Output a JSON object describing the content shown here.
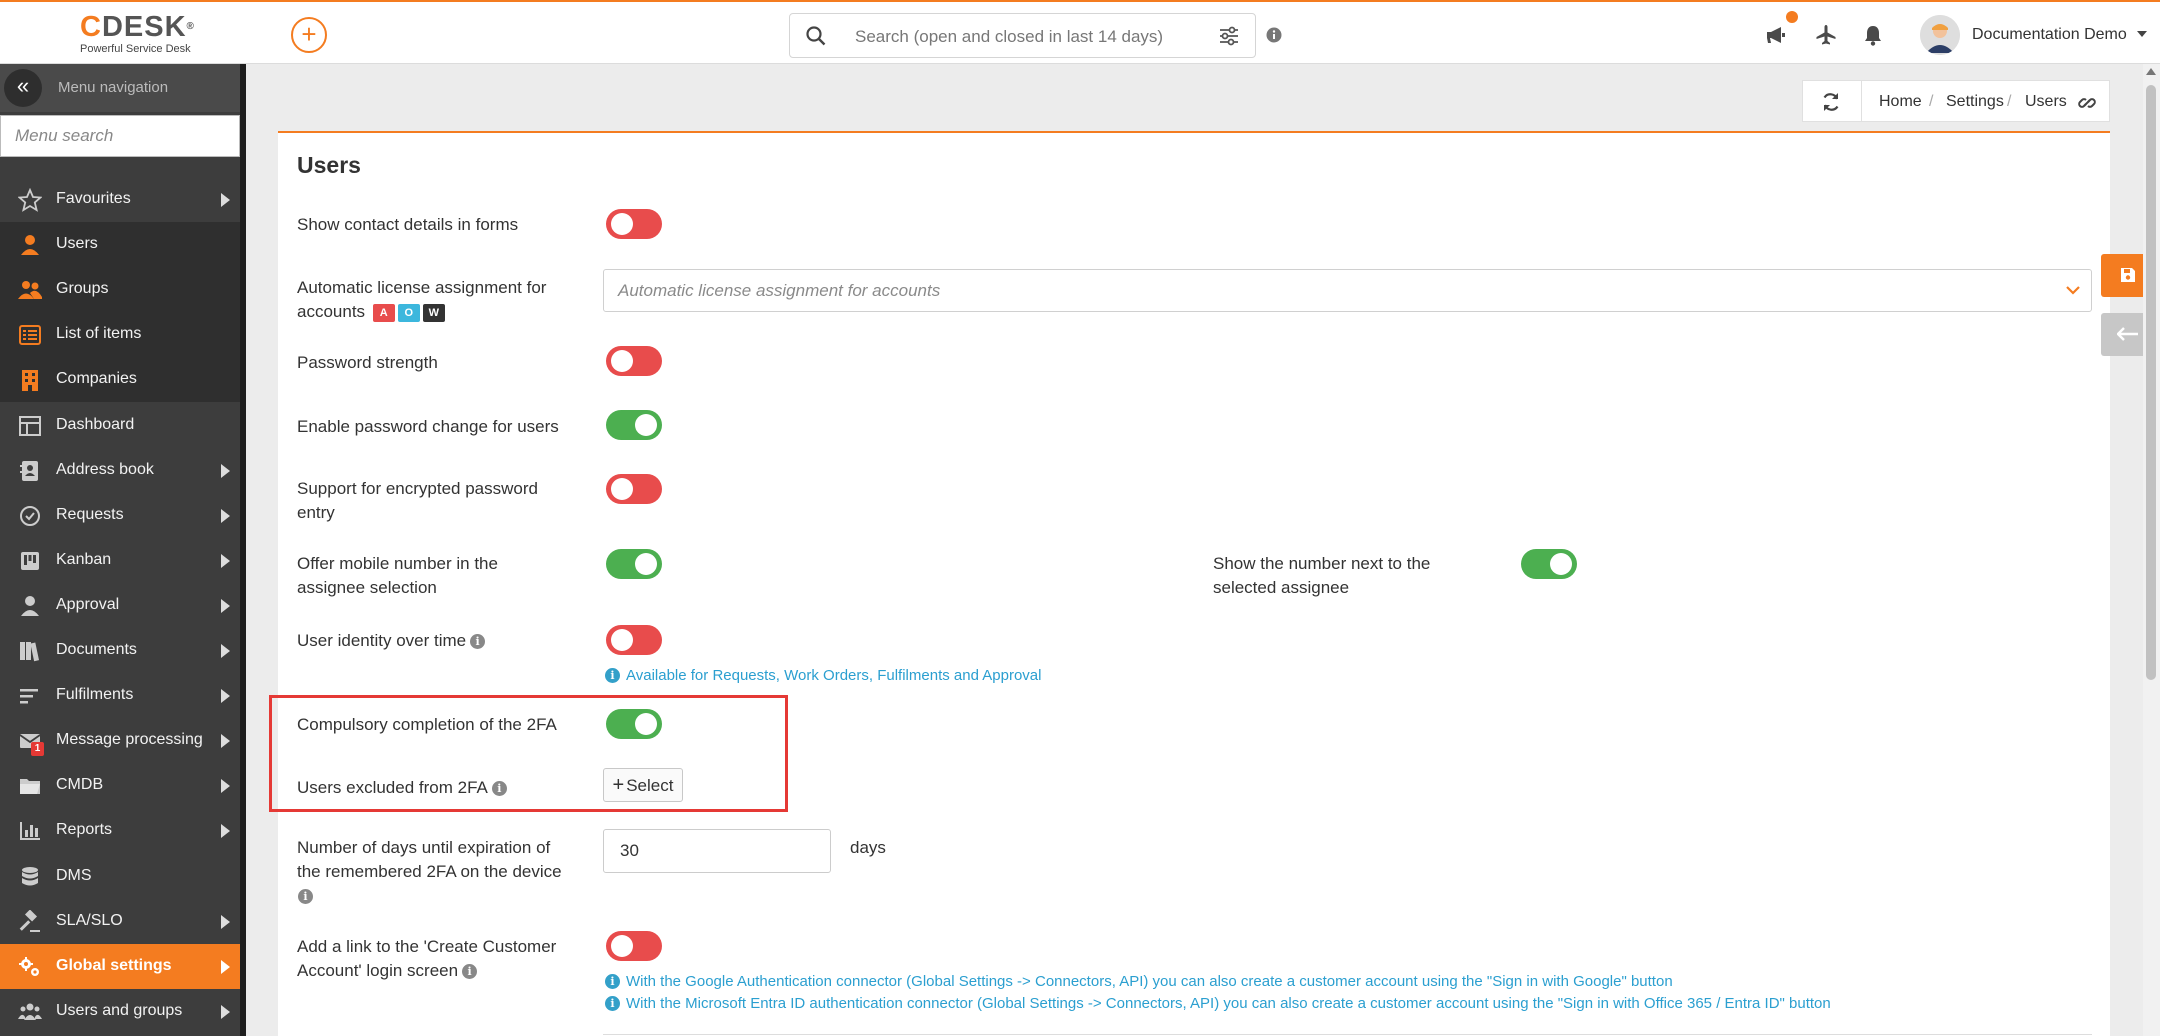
{
  "header": {
    "logo_text": "CDESK",
    "logo_sup": "®",
    "logo_subtitle": "Powerful Service Desk",
    "search_placeholder": "Search (open and closed in last 14 days)",
    "user_name": "Documentation Demo",
    "accent_color": "#f47c20"
  },
  "sidebar": {
    "nav_label": "Menu navigation",
    "search_placeholder": "Menu search",
    "items": [
      {
        "label": "Favourites",
        "icon": "star-icon",
        "submenu": true
      },
      {
        "label": "Users",
        "icon": "user-icon",
        "submenu": false
      },
      {
        "label": "Groups",
        "icon": "group-icon",
        "submenu": false
      },
      {
        "label": "List of items",
        "icon": "list-icon",
        "submenu": false
      },
      {
        "label": "Companies",
        "icon": "building-icon",
        "submenu": false
      },
      {
        "label": "Dashboard",
        "icon": "dashboard-icon",
        "submenu": false
      },
      {
        "label": "Address book",
        "icon": "address-book-icon",
        "submenu": true
      },
      {
        "label": "Requests",
        "icon": "requests-icon",
        "submenu": true
      },
      {
        "label": "Kanban",
        "icon": "kanban-icon",
        "submenu": true
      },
      {
        "label": "Approval",
        "icon": "approval-icon",
        "submenu": true
      },
      {
        "label": "Documents",
        "icon": "documents-icon",
        "submenu": true
      },
      {
        "label": "Fulfilments",
        "icon": "fulfilments-icon",
        "submenu": true
      },
      {
        "label": "Message processing",
        "icon": "envelope-icon",
        "submenu": true,
        "badge": "1"
      },
      {
        "label": "CMDB",
        "icon": "folder-icon",
        "submenu": true
      },
      {
        "label": "Reports",
        "icon": "chart-icon",
        "submenu": true
      },
      {
        "label": "DMS",
        "icon": "database-icon",
        "submenu": false
      },
      {
        "label": "SLA/SLO",
        "icon": "gavel-icon",
        "submenu": true
      },
      {
        "label": "Global settings",
        "icon": "cogs-icon",
        "submenu": true,
        "active": true
      },
      {
        "label": "Users and groups",
        "icon": "users-icon",
        "submenu": true
      }
    ]
  },
  "breadcrumb": {
    "items": [
      "Home",
      "Settings",
      "Users"
    ]
  },
  "main": {
    "title": "Users",
    "settings": {
      "show_contact": {
        "label": "Show contact details in forms",
        "value": "off"
      },
      "auto_license": {
        "label": "Automatic license assignment for accounts",
        "placeholder": "Automatic license assignment for accounts",
        "chips": [
          "A",
          "O",
          "W"
        ]
      },
      "password_strength": {
        "label": "Password strength",
        "value": "off"
      },
      "password_change": {
        "label": "Enable password change for users",
        "value": "on"
      },
      "encrypted_password": {
        "label": "Support for encrypted password entry",
        "value": "off"
      },
      "mobile_number": {
        "label": "Offer mobile number in the assignee selection",
        "value": "on"
      },
      "show_number": {
        "label": "Show the number next to the selected assignee",
        "value": "on"
      },
      "user_identity": {
        "label": "User identity over time",
        "value": "off",
        "hint": "Available for Requests, Work Orders, Fulfilments and Approval"
      },
      "compulsory_2fa": {
        "label": "Compulsory completion of the 2FA",
        "value": "on"
      },
      "excluded_2fa": {
        "label": "Users excluded from 2FA",
        "button": "Select"
      },
      "expiration_days": {
        "label": "Number of days until expiration of the remembered 2FA on the device",
        "value": "30",
        "unit": "days"
      },
      "customer_account_link": {
        "label": "Add a link to the 'Create Customer Account' login screen",
        "value": "off",
        "hints": [
          "With the Google Authentication connector (Global Settings -> Connectors, API) you can also create a customer account using the \"Sign in with Google\" button",
          "With the Microsoft Entra ID authentication connector (Global Settings -> Connectors, API) you can also create a customer account using the \"Sign in with Office 365 / Entra ID\" button"
        ]
      }
    }
  }
}
